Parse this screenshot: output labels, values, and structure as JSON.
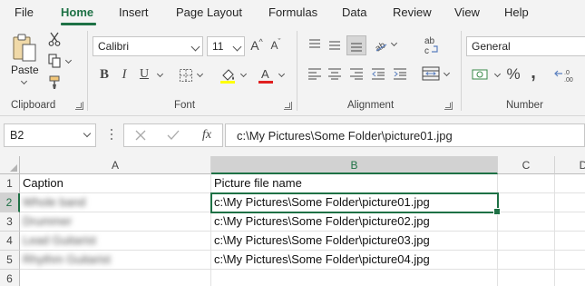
{
  "tabs": [
    "File",
    "Home",
    "Insert",
    "Page Layout",
    "Formulas",
    "Data",
    "Review",
    "View",
    "Help"
  ],
  "active_tab": "Home",
  "ribbon": {
    "clipboard": {
      "paste_label": "Paste",
      "group_label": "Clipboard"
    },
    "font": {
      "font_name": "Calibri",
      "font_size": "11",
      "group_label": "Font"
    },
    "alignment": {
      "group_label": "Alignment"
    },
    "number": {
      "format": "General",
      "group_label": "Number"
    }
  },
  "formula_bar": {
    "name_box": "B2",
    "fx_label": "fx",
    "content": "c:\\My Pictures\\Some Folder\\picture01.jpg"
  },
  "columns": [
    "A",
    "B",
    "C",
    "D"
  ],
  "rows": [
    "1",
    "2",
    "3",
    "4",
    "5",
    "6"
  ],
  "cells": {
    "a1": "Caption",
    "b1": "Picture file name",
    "a2": "Whole band",
    "a3": "Drummer",
    "a4": "Lead Guitarist",
    "a5": "Rhythm Guitarist",
    "b2": "c:\\My Pictures\\Some Folder\\picture01.jpg",
    "b3": "c:\\My Pictures\\Some Folder\\picture02.jpg",
    "b4": "c:\\My Pictures\\Some Folder\\picture03.jpg",
    "b5": "c:\\My Pictures\\Some Folder\\picture04.jpg"
  },
  "icons": {
    "cut": "scissors-icon",
    "copy": "copy-icon",
    "format_painter": "paintbrush-icon",
    "increase_font": "increase-font-icon",
    "decrease_font": "decrease-font-icon",
    "bold": "bold-icon",
    "italic": "italic-icon",
    "underline": "underline-icon",
    "borders": "borders-icon",
    "fill_color": "fill-color-icon",
    "font_color": "font-color-icon",
    "wrap_text": "wrap-text-icon",
    "merge_center": "merge-center-icon",
    "currency": "currency-icon",
    "percent": "percent-icon",
    "comma": "comma-style-icon",
    "increase_decimal": "increase-decimal-icon"
  },
  "colors": {
    "accent": "#1e7145",
    "fill_color_swatch": "#ffff00",
    "font_color_swatch": "#e02020"
  }
}
